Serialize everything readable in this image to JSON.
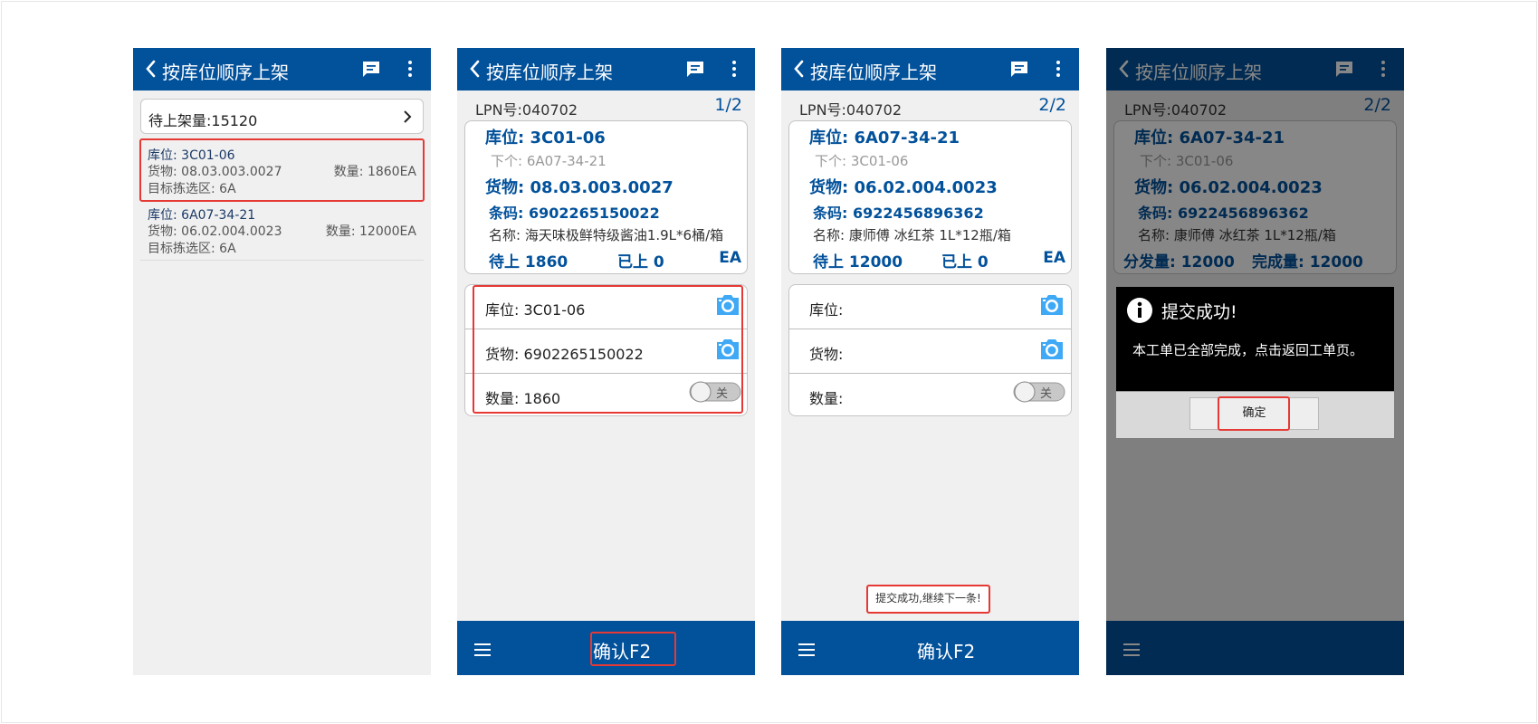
{
  "common": {
    "title": "按库位顺序上架",
    "confirm_label": "确认F2"
  },
  "screen1": {
    "pending_label": "待上架量:15120",
    "items": [
      {
        "location": "库位: 3C01-06",
        "goods": "货物: 08.03.003.0027",
        "qty": "数量: 1860EA",
        "zone": "目标拣选区: 6A"
      },
      {
        "location": "库位: 6A07-34-21",
        "goods": "货物: 06.02.004.0023",
        "qty": "数量: 12000EA",
        "zone": "目标拣选区: 6A"
      }
    ]
  },
  "screen2": {
    "lpn": "LPN号:040702",
    "page": "1/2",
    "location": "库位: 3C01-06",
    "next": "下个: 6A07-34-21",
    "goods": "货物: 08.03.003.0027",
    "barcode": "条码: 6902265150022",
    "name": "名称: 海天味极鲜特级酱油1.9L*6桶/箱",
    "pending": "待上 1860",
    "done": "已上 0",
    "unit": "EA",
    "input_location": "库位: 3C01-06",
    "input_goods": "货物: 6902265150022",
    "input_qty": "数量: 1860",
    "toggle_label": "关"
  },
  "screen3": {
    "lpn": "LPN号:040702",
    "page": "2/2",
    "location": "库位: 6A07-34-21",
    "next": "下个: 3C01-06",
    "goods": "货物: 06.02.004.0023",
    "barcode": "条码: 6922456896362",
    "name": "名称: 康师傅 冰红茶 1L*12瓶/箱",
    "pending": "待上 12000",
    "done": "已上 0",
    "unit": "EA",
    "input_location": "库位:",
    "input_goods": "货物:",
    "input_qty": "数量:",
    "toggle_label": "关",
    "toast": "提交成功,继续下一条!"
  },
  "screen4": {
    "lpn": "LPN号:040702",
    "page": "2/2",
    "location": "库位: 6A07-34-21",
    "next": "下个: 3C01-06",
    "goods": "货物: 06.02.004.0023",
    "barcode": "条码: 6922456896362",
    "name": "名称: 康师傅 冰红茶 1L*12瓶/箱",
    "dispatched": "分发量: 12000",
    "completed": "完成量: 12000",
    "dialog_title": "提交成功!",
    "dialog_body": "本工单已全部完成，点击返回工单页。",
    "dialog_ok": "确定"
  },
  "colors": {
    "primary": "#02519b",
    "highlight": "#e53935",
    "camera": "#3fa9f5"
  },
  "icons": [
    "back-icon",
    "message-icon",
    "more-icon",
    "chevron-right-icon",
    "camera-icon",
    "toggle-switch",
    "menu-icon",
    "info-icon"
  ]
}
